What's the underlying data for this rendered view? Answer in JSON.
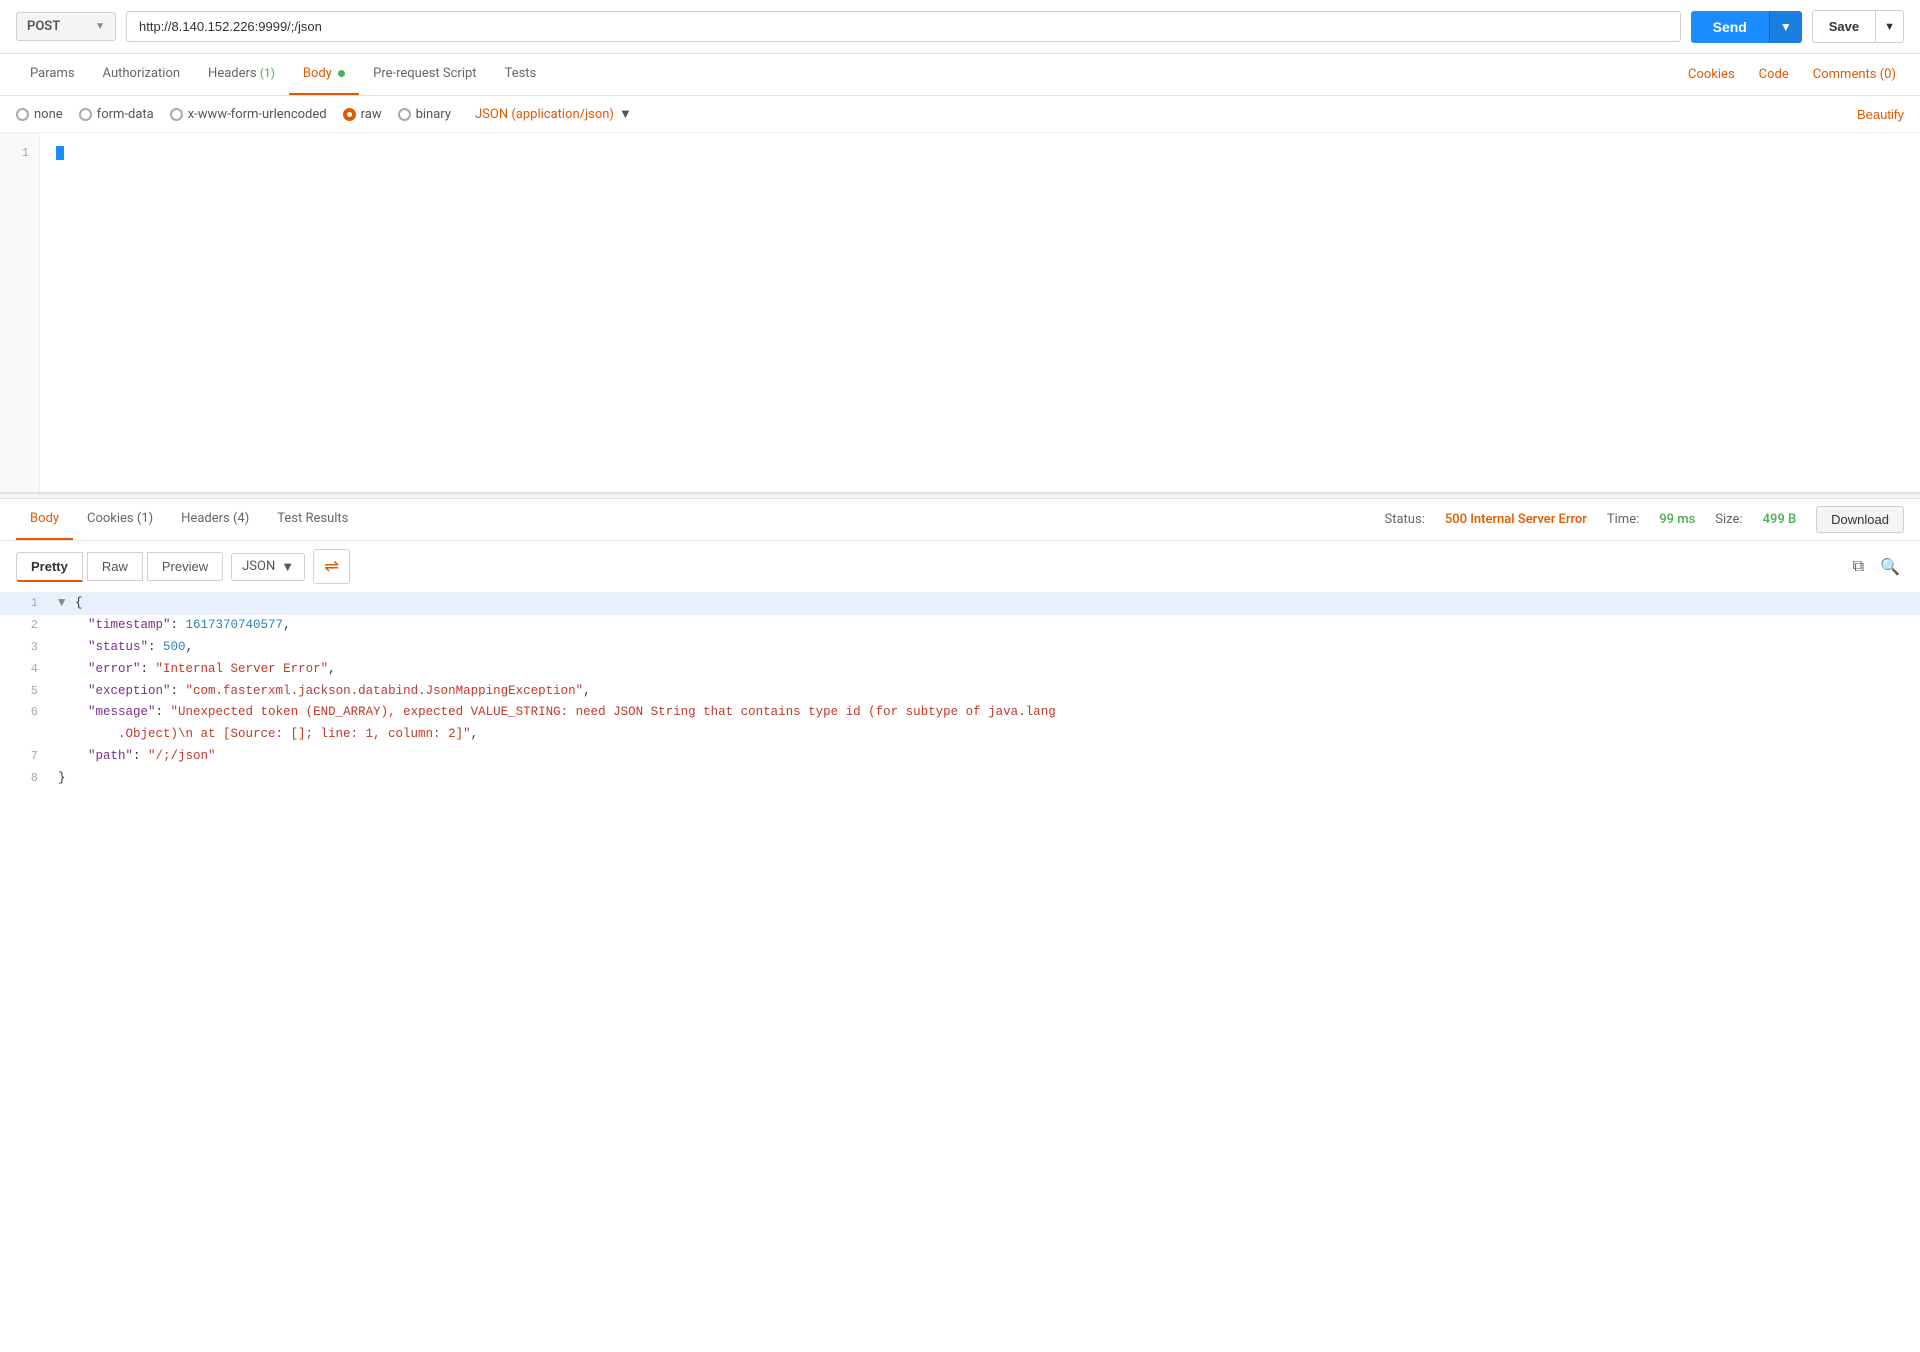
{
  "topbar": {
    "method": "POST",
    "url": "http://8.140.152.226:9999/;/json",
    "send_label": "Send",
    "save_label": "Save"
  },
  "request_tabs": {
    "items": [
      {
        "id": "params",
        "label": "Params",
        "badge": ""
      },
      {
        "id": "authorization",
        "label": "Authorization",
        "badge": ""
      },
      {
        "id": "headers",
        "label": "Headers",
        "badge": " (1)"
      },
      {
        "id": "body",
        "label": "Body",
        "badge": "",
        "dot": true,
        "active": true
      },
      {
        "id": "pre-request",
        "label": "Pre-request Script",
        "badge": ""
      },
      {
        "id": "tests",
        "label": "Tests",
        "badge": ""
      }
    ],
    "right": [
      "Cookies",
      "Code",
      "Comments (0)"
    ]
  },
  "body_options": {
    "options": [
      "none",
      "form-data",
      "x-www-form-urlencoded",
      "raw",
      "binary"
    ],
    "active": "raw",
    "json_type": "JSON (application/json)",
    "beautify": "Beautify"
  },
  "editor": {
    "lines": [
      "[]"
    ]
  },
  "response": {
    "tabs": [
      {
        "id": "body",
        "label": "Body",
        "active": true
      },
      {
        "id": "cookies",
        "label": "Cookies (1)"
      },
      {
        "id": "headers",
        "label": "Headers (4)"
      },
      {
        "id": "test-results",
        "label": "Test Results"
      }
    ],
    "status_label": "Status:",
    "status_value": "500 Internal Server Error",
    "time_label": "Time:",
    "time_value": "99 ms",
    "size_label": "Size:",
    "size_value": "499 B",
    "download_label": "Download"
  },
  "response_toolbar": {
    "views": [
      "Pretty",
      "Raw",
      "Preview"
    ],
    "active_view": "Pretty",
    "format": "JSON",
    "wrap_icon": "↩"
  },
  "response_body": {
    "lines": [
      {
        "ln": "1",
        "collapse": true,
        "content": "{",
        "highlight": true
      },
      {
        "ln": "2",
        "content": "    \"timestamp\": 1617370740577,",
        "key": "timestamp",
        "val_num": "1617370740577"
      },
      {
        "ln": "3",
        "content": "    \"status\": 500,",
        "key": "status",
        "val_num": "500"
      },
      {
        "ln": "4",
        "content": "    \"error\": \"Internal Server Error\",",
        "key": "error",
        "val_str": "Internal Server Error"
      },
      {
        "ln": "5",
        "content": "    \"exception\": \"com.fasterxml.jackson.databind.JsonMappingException\",",
        "key": "exception",
        "val_str": "com.fasterxml.jackson.databind.JsonMappingException"
      },
      {
        "ln": "6",
        "content": "    \"message\": \"Unexpected token (END_ARRAY), expected VALUE_STRING: need JSON String that contains type id (for subtype of java.lang.Object)\\n at [Source: []; line: 1, column: 2]\",",
        "key": "message",
        "val_str": "Unexpected token (END_ARRAY), expected VALUE_STRING: need JSON String that contains type id (for subtype of java.lang.Object)\\n at [Source: []; line: 1, column: 2]"
      },
      {
        "ln": "7",
        "content": "    \"path\": \"/;/json\"",
        "key": "path",
        "val_str": "/;/json"
      },
      {
        "ln": "8",
        "content": "}"
      }
    ]
  }
}
